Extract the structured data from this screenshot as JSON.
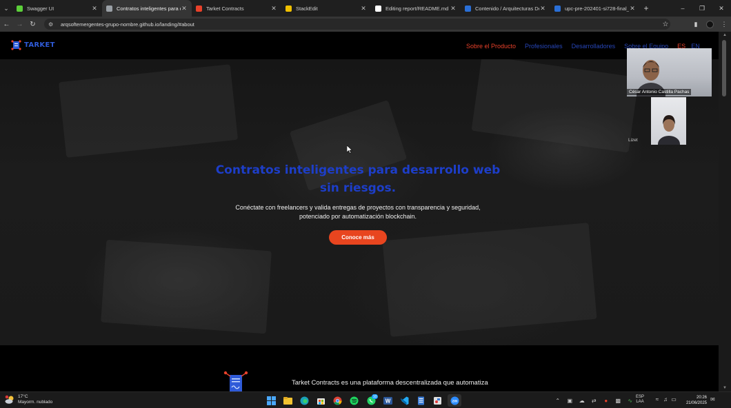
{
  "browser": {
    "tabs": [
      {
        "title": "Swagger UI",
        "icon": "swagger-icon",
        "color": "#5ccf3a",
        "active": false
      },
      {
        "title": "Contratos inteligentes para des",
        "icon": "globe-icon",
        "color": "#9aa0a6",
        "active": true
      },
      {
        "title": "Tarket Contracts",
        "icon": "tarket-icon",
        "color": "#e8412a",
        "active": false
      },
      {
        "title": "StackEdit",
        "icon": "stackedit-icon",
        "color": "#f0c000",
        "active": false
      },
      {
        "title": "Editing report/README.md at",
        "icon": "github-icon",
        "color": "#ffffff",
        "active": false
      },
      {
        "title": "Contenido / Arquitecturas De",
        "icon": "blackboard-icon",
        "color": "#2a6fd6",
        "active": false
      },
      {
        "title": "upc-pre-202401-si728-final_p",
        "icon": "blackboard-icon",
        "color": "#2a6fd6",
        "active": false
      }
    ],
    "url": "arqsoftemergentes-grupo-nombre.github.io/landing/#about"
  },
  "site": {
    "logo_text": "TARKET",
    "brand_color": "#2f5bd8",
    "accent_color": "#e8451f",
    "nav": [
      {
        "label": "Sobre el Producto",
        "active": true
      },
      {
        "label": "Profesionales",
        "active": false
      },
      {
        "label": "Desarrolladores",
        "active": false
      },
      {
        "label": "Sobre el Equipo",
        "active": false
      }
    ],
    "lang_es": "ES",
    "lang_en": "EN",
    "hero": {
      "title": "Contratos inteligentes para desarrollo web sin riesgos.",
      "subtitle": "Conéctate con freelancers y valida entregas de proyectos con transparencia y seguridad, potenciado por automatización blockchain.",
      "cta": "Conoce más"
    },
    "about_text": "Tarket Contracts es una plataforma descentralizada que automatiza"
  },
  "meeting": {
    "participant1": "César Antonio Castilla Pachas",
    "participant2": "Lizet"
  },
  "taskbar": {
    "weather_temp": "17°C",
    "weather_desc": "Mayorm. nublado",
    "apps": [
      {
        "name": "windows-start-icon"
      },
      {
        "name": "file-explorer-icon"
      },
      {
        "name": "edge-icon"
      },
      {
        "name": "store-icon"
      },
      {
        "name": "chrome-icon"
      },
      {
        "name": "spotify-icon"
      },
      {
        "name": "whatsapp-icon",
        "badge": "10"
      },
      {
        "name": "word-icon"
      },
      {
        "name": "vscode-icon"
      },
      {
        "name": "notepad-icon"
      },
      {
        "name": "snipping-icon"
      },
      {
        "name": "zoom-icon"
      }
    ],
    "lang_line1": "ESP",
    "lang_line2": "LAA",
    "time": "20:26",
    "date": "21/06/2025"
  }
}
